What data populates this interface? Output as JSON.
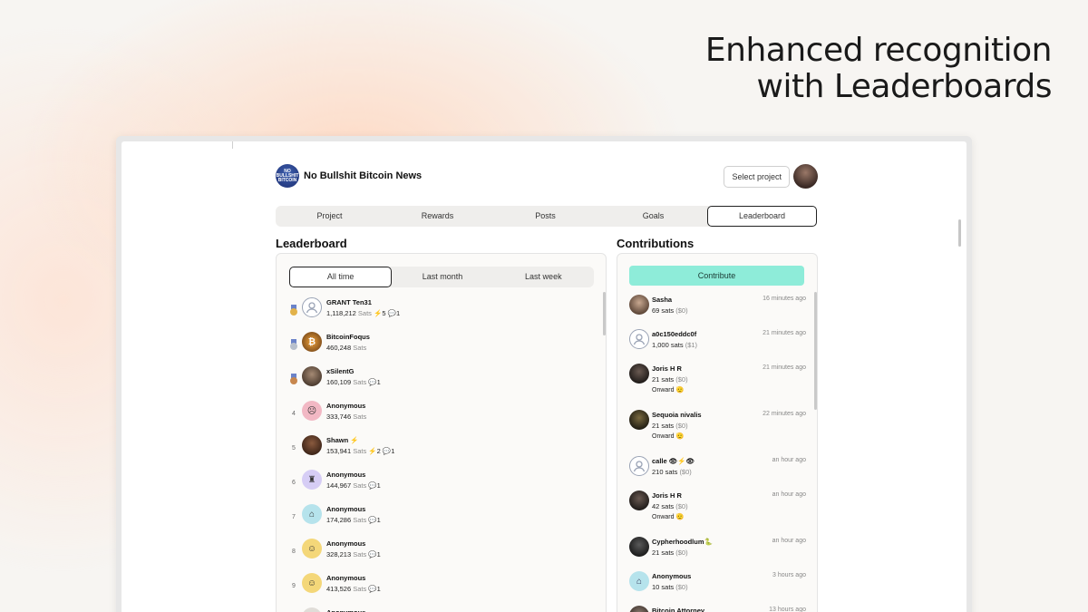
{
  "headline": {
    "line1": "Enhanced recognition",
    "line2": "with Leaderboards"
  },
  "project": {
    "title": "No Bullshit Bitcoin News",
    "logo_text": "NO BULLSHIT BITCOIN"
  },
  "header": {
    "select_project": "Select project"
  },
  "tabs": [
    {
      "label": "Project"
    },
    {
      "label": "Rewards"
    },
    {
      "label": "Posts"
    },
    {
      "label": "Goals"
    },
    {
      "label": "Leaderboard",
      "active": true
    }
  ],
  "leaderboard": {
    "title": "Leaderboard",
    "filters": [
      {
        "label": "All time",
        "active": true
      },
      {
        "label": "Last month"
      },
      {
        "label": "Last week"
      }
    ],
    "unit": "Sats",
    "rows": [
      {
        "rank": "",
        "medal": "gold",
        "name": "GRANT Ten31",
        "amount": "1,118,212",
        "zaps": "5",
        "comments": "1",
        "avatar": "default-avatar-icon"
      },
      {
        "rank": "",
        "medal": "silver",
        "name": "BitcoinFoqus",
        "amount": "460,248",
        "zaps": "",
        "comments": "",
        "avatar": "bitcoin-avatar-icon"
      },
      {
        "rank": "",
        "medal": "bronze",
        "name": "xSilentG",
        "amount": "160,109",
        "zaps": "",
        "comments": "1",
        "avatar": "photo-avatar-icon"
      },
      {
        "rank": "4",
        "medal": "",
        "name": "Anonymous",
        "amount": "333,746",
        "zaps": "",
        "comments": "",
        "avatar": "anon-avatar-icon"
      },
      {
        "rank": "5",
        "medal": "",
        "name": "Shawn ⚡",
        "amount": "153,941",
        "zaps": "2",
        "comments": "1",
        "avatar": "photo-avatar-icon"
      },
      {
        "rank": "6",
        "medal": "",
        "name": "Anonymous",
        "amount": "144,967",
        "zaps": "",
        "comments": "1",
        "avatar": "anon-avatar-icon"
      },
      {
        "rank": "7",
        "medal": "",
        "name": "Anonymous",
        "amount": "174,286",
        "zaps": "",
        "comments": "1",
        "avatar": "anon-avatar-icon"
      },
      {
        "rank": "8",
        "medal": "",
        "name": "Anonymous",
        "amount": "328,213",
        "zaps": "",
        "comments": "1",
        "avatar": "anon-avatar-icon"
      },
      {
        "rank": "9",
        "medal": "",
        "name": "Anonymous",
        "amount": "413,526",
        "zaps": "",
        "comments": "1",
        "avatar": "anon-avatar-icon"
      },
      {
        "rank": "",
        "medal": "",
        "name": "Anonymous",
        "amount": "",
        "zaps": "",
        "comments": "",
        "avatar": "anon-avatar-icon"
      }
    ]
  },
  "contributions": {
    "title": "Contributions",
    "button": "Contribute",
    "rows": [
      {
        "name": "Sasha",
        "amount": "69 sats",
        "usd": "($0)",
        "time": "16 minutes ago",
        "note": ""
      },
      {
        "name": "a0c150eddc0f",
        "amount": "1,000 sats",
        "usd": "($1)",
        "time": "21 minutes ago",
        "note": ""
      },
      {
        "name": "Joris H R",
        "amount": "21 sats",
        "usd": "($0)",
        "time": "21 minutes ago",
        "note": "Onward 🫡"
      },
      {
        "name": "Sequoia nivalis",
        "amount": "21 sats",
        "usd": "($0)",
        "time": "22 minutes ago",
        "note": "Onward 🫡"
      },
      {
        "name": "calle 👁⚡👁",
        "amount": "210 sats",
        "usd": "($0)",
        "time": "an hour ago",
        "note": ""
      },
      {
        "name": "Joris H R",
        "amount": "42 sats",
        "usd": "($0)",
        "time": "an hour ago",
        "note": "Onward 🫡"
      },
      {
        "name": "Cypherhoodlum🐍",
        "amount": "21 sats",
        "usd": "($0)",
        "time": "an hour ago",
        "note": ""
      },
      {
        "name": "Anonymous",
        "amount": "10 sats",
        "usd": "($0)",
        "time": "3 hours ago",
        "note": ""
      },
      {
        "name": "Bitcoin Attorney",
        "amount": "",
        "usd": "",
        "time": "13 hours ago",
        "note": ""
      }
    ]
  },
  "colors": {
    "accent": "#8eecd9",
    "gold": "#e2b24a",
    "silver": "#b8c0cc",
    "bronze": "#c7874e"
  }
}
